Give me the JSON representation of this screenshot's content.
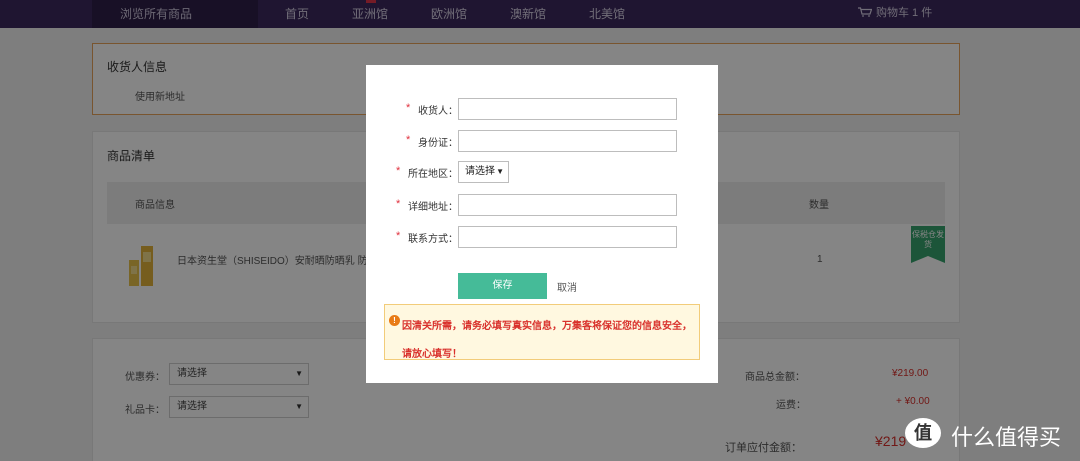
{
  "topnav": {
    "browse_label": "浏览所有商品",
    "items": [
      {
        "label": "首页"
      },
      {
        "label": "亚洲馆"
      },
      {
        "label": "欧洲馆"
      },
      {
        "label": "澳新馆"
      },
      {
        "label": "北美馆"
      }
    ],
    "cart_label": "购物车 1 件",
    "cart_icon": "cart-icon"
  },
  "receiver": {
    "title": "收货人信息",
    "use_new_address": "使用新地址"
  },
  "goods": {
    "title": "商品清单",
    "columns": [
      "商品信息",
      "数量"
    ],
    "item": {
      "name": "日本资生堂（SHISEIDO）安耐晒防晒乳 防",
      "quantity": "1"
    },
    "badge": "保税仓发货"
  },
  "summary": {
    "coupon_label": "优惠券：",
    "coupon_value": "请选择",
    "giftcard_label": "礼品卡：",
    "giftcard_value": "请选择",
    "goods_total_label": "商品总金额：",
    "goods_total": "¥219.00",
    "shipping_label": "运费：",
    "shipping": "+ ¥0.00",
    "order_total_label": "订单应付金额：",
    "order_total": "¥219"
  },
  "modal": {
    "fields": {
      "receiver": "收货人：",
      "id_card": "身份证：",
      "region": "所在地区：",
      "address": "详细地址：",
      "contact": "联系方式："
    },
    "region_select_value": "请选择",
    "required_mark": "*",
    "save_label": "保存",
    "cancel_label": "取消",
    "notice": "因清关所需，请务必填写真实信息，万集客将保证您的信息安全，请放心填写！",
    "notice_icon": "warning-icon"
  },
  "watermark": {
    "logo": "值",
    "text": "什么值得买"
  },
  "colors": {
    "nav_bg": "#3d2a5e",
    "accent_green": "#45bb98",
    "price_red": "#d9312c",
    "border_orange": "#e8a35a"
  }
}
